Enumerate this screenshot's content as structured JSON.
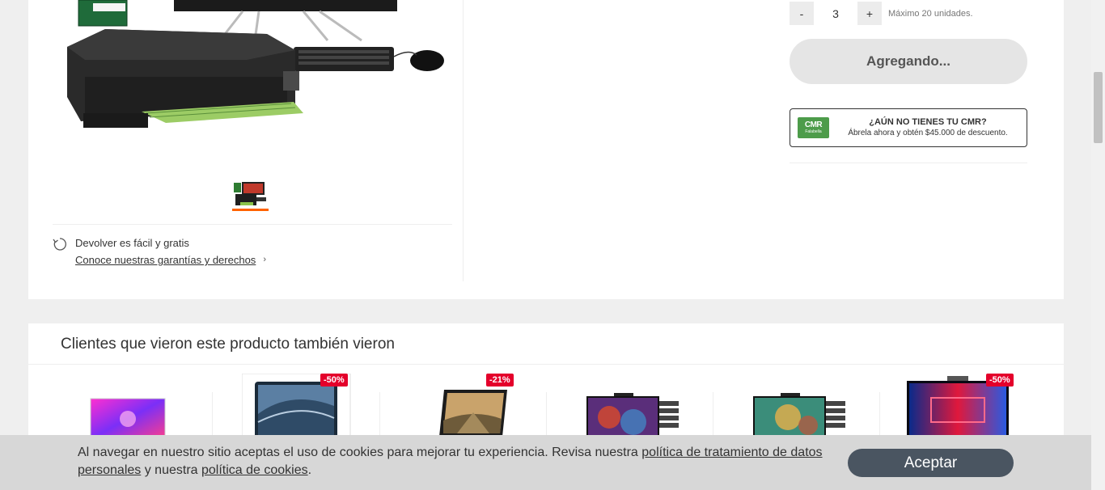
{
  "product": {
    "image_alt": "Computador HP y multifuncional",
    "return_title": "Devolver es fácil y gratis",
    "return_link": "Conoce nuestras garantías y derechos"
  },
  "cart": {
    "minus_label": "-",
    "quantity": "3",
    "plus_label": "+",
    "max_units": "Máximo 20 unidades.",
    "add_button": "Agregando..."
  },
  "cmr": {
    "logo_text": "CMR",
    "logo_sub": "Falabella",
    "title": "¿AÚN NO TIENES TU CMR?",
    "subtitle": "Ábrela ahora y obtén $45.000 de descuento."
  },
  "recommendations": {
    "title": "Clientes que vieron este producto también vieron",
    "items": [
      {
        "kind": "neon-laptop",
        "discount": ""
      },
      {
        "kind": "laptop-waves",
        "discount": "-50%"
      },
      {
        "kind": "laptop-landscape",
        "discount": "-21%"
      },
      {
        "kind": "aio-game",
        "discount": ""
      },
      {
        "kind": "aio-fighter",
        "discount": ""
      },
      {
        "kind": "aio-red",
        "discount": "-50%"
      }
    ]
  },
  "cookies": {
    "text_before": "Al navegar en nuestro sitio aceptas el uso de cookies para mejorar tu experiencia. Revisa nuestra ",
    "link_privacy": "política de tratamiento de datos personales",
    "text_middle": " y nuestra ",
    "link_cookies": "política de cookies",
    "text_after": ".",
    "accept": "Aceptar"
  },
  "colors": {
    "accent": "#ff6200",
    "discount": "#e4002b",
    "cmr_green": "#4d9c4a",
    "accept_button": "#4a5561"
  }
}
